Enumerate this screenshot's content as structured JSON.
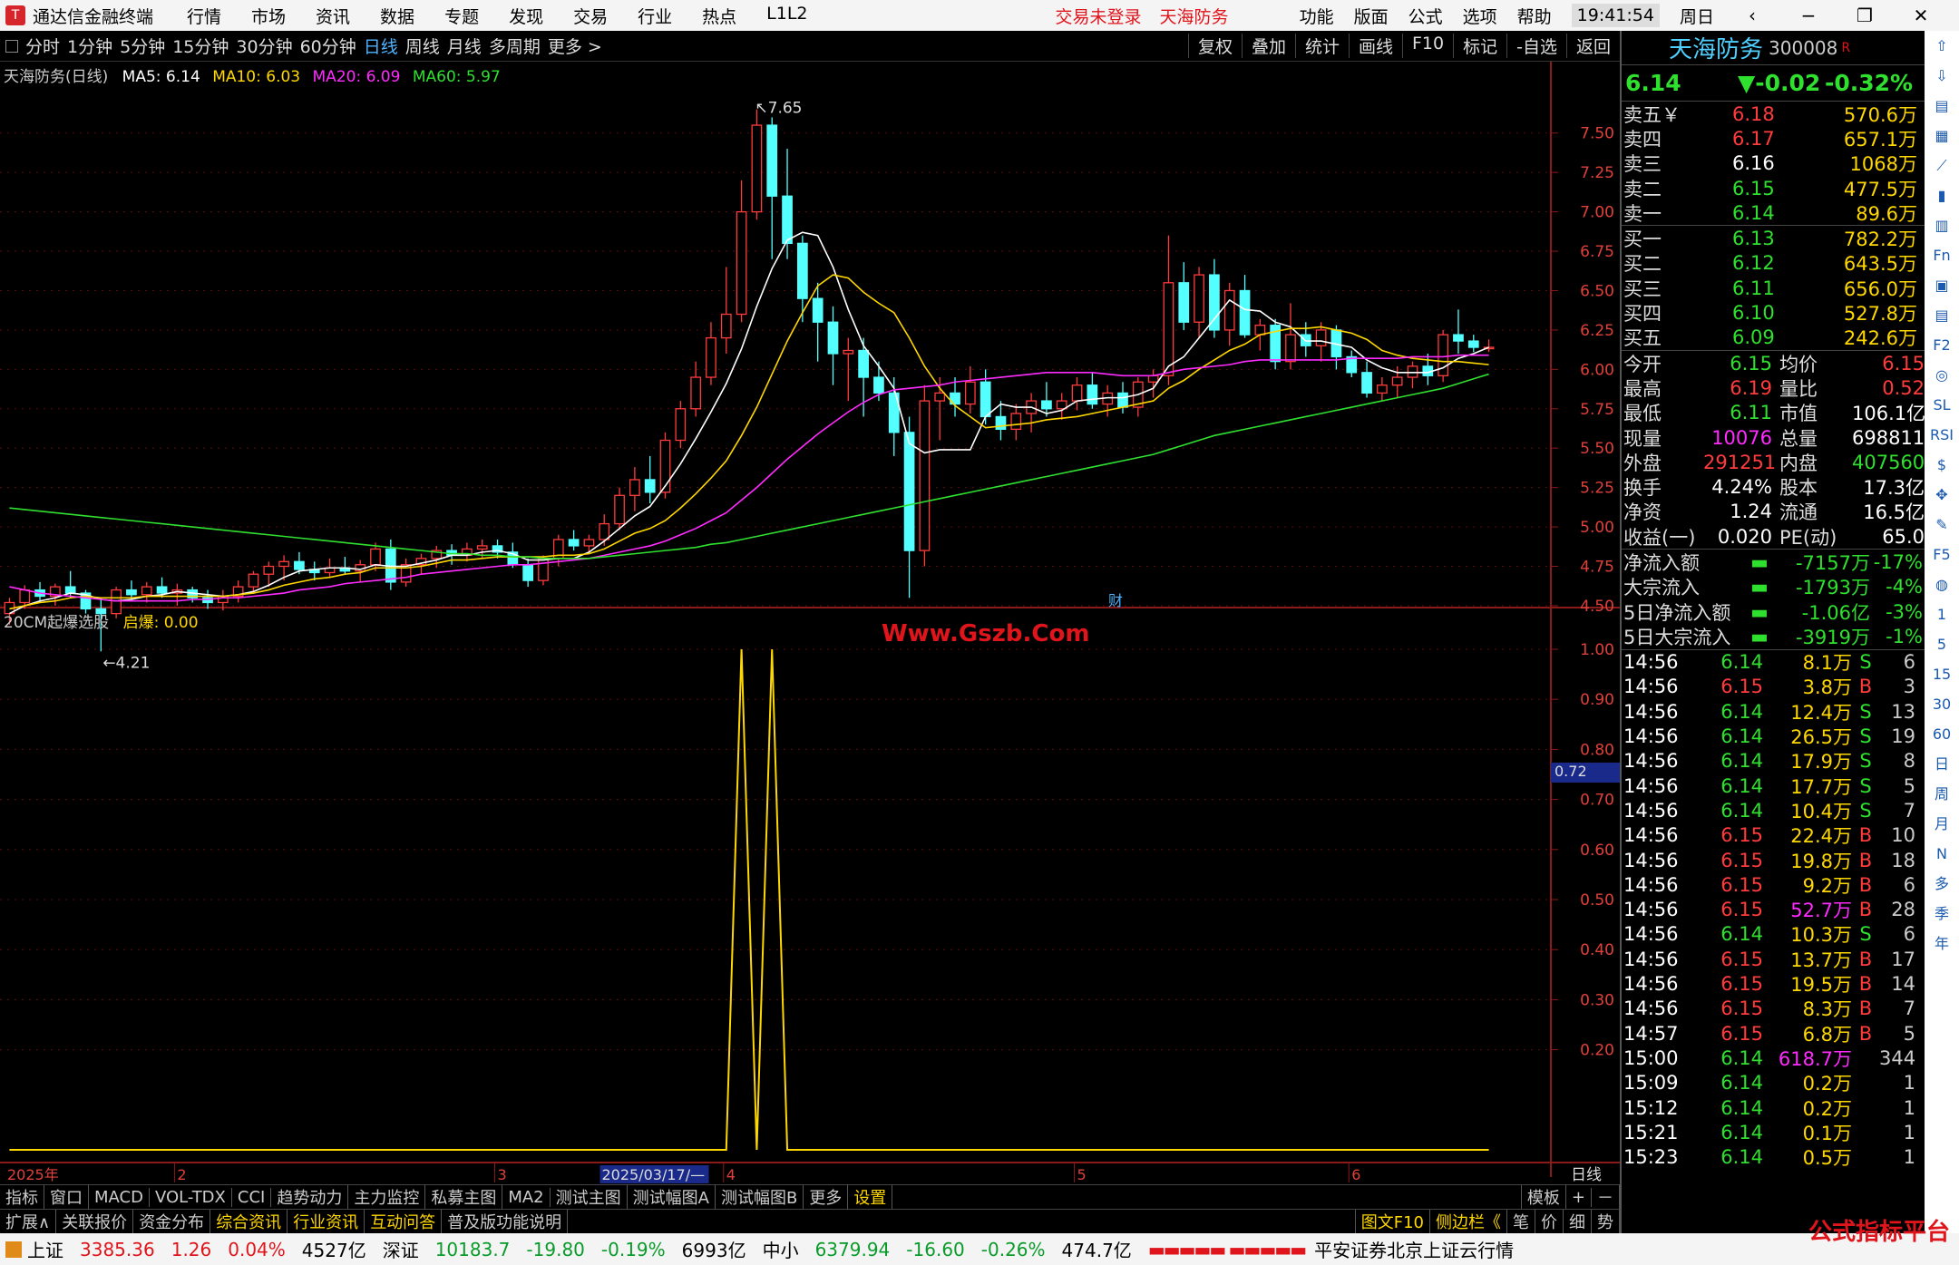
{
  "app": {
    "title": "通达信金融终端",
    "menu": [
      "行情",
      "市场",
      "资讯",
      "数据",
      "专题",
      "发现",
      "交易",
      "行业",
      "热点",
      "L1L2"
    ],
    "warning": "交易未登录",
    "stock_tag": "天海防务",
    "right_menu": [
      "功能",
      "版面",
      "公式",
      "选项",
      "帮助"
    ],
    "clock": "19:41:54",
    "weekday": "周日"
  },
  "toolbar": {
    "timeframes": [
      "分时",
      "1分钟",
      "5分钟",
      "15分钟",
      "30分钟",
      "60分钟",
      "日线",
      "周线",
      "月线",
      "多周期",
      "更多 >"
    ],
    "active": "日线",
    "tools": [
      "复权",
      "叠加",
      "统计",
      "画线",
      "F10",
      "标记",
      "-自选",
      "返回"
    ]
  },
  "chart_info": {
    "name": "天海防务(日线)",
    "ma5": "MA5: 6.14",
    "ma10": "MA10: 6.03",
    "ma20": "MA20: 6.09",
    "ma60": "MA60: 5.97",
    "high_label": "7.65",
    "low_label": "4.21",
    "cai": "财"
  },
  "indicator_info": {
    "name": "20CM起爆选股",
    "value_label": "启爆: 0.00",
    "watermark": "Www.Gszb.Com",
    "current_value": "0.72"
  },
  "axes": {
    "price_ticks": [
      "7.50",
      "7.25",
      "7.00",
      "6.75",
      "6.50",
      "6.25",
      "6.00",
      "5.75",
      "5.50",
      "5.25",
      "5.00",
      "4.75",
      "4.50"
    ],
    "ind_ticks": [
      "1.00",
      "0.90",
      "0.80",
      "0.70",
      "0.60",
      "0.50",
      "0.40",
      "0.30",
      "0.20"
    ],
    "date_labels": [
      "2025年",
      "2",
      "3",
      "2025/03/17/—",
      "4",
      "5",
      "6"
    ],
    "period": "日线"
  },
  "chart_data": {
    "type": "candlestick",
    "ohlc": [
      [
        4.45,
        4.55,
        4.38,
        4.52
      ],
      [
        4.52,
        4.63,
        4.48,
        4.6
      ],
      [
        4.6,
        4.65,
        4.52,
        4.56
      ],
      [
        4.56,
        4.64,
        4.5,
        4.62
      ],
      [
        4.62,
        4.72,
        4.55,
        4.58
      ],
      [
        4.58,
        4.6,
        4.45,
        4.48
      ],
      [
        4.48,
        4.55,
        4.21,
        4.45
      ],
      [
        4.45,
        4.62,
        4.42,
        4.6
      ],
      [
        4.6,
        4.66,
        4.54,
        4.57
      ],
      [
        4.57,
        4.65,
        4.52,
        4.62
      ],
      [
        4.62,
        4.68,
        4.55,
        4.58
      ],
      [
        4.58,
        4.64,
        4.5,
        4.6
      ],
      [
        4.6,
        4.62,
        4.52,
        4.55
      ],
      [
        4.55,
        4.6,
        4.48,
        4.52
      ],
      [
        4.52,
        4.6,
        4.47,
        4.56
      ],
      [
        4.56,
        4.66,
        4.52,
        4.62
      ],
      [
        4.62,
        4.72,
        4.58,
        4.7
      ],
      [
        4.7,
        4.78,
        4.62,
        4.75
      ],
      [
        4.75,
        4.82,
        4.66,
        4.78
      ],
      [
        4.78,
        4.84,
        4.7,
        4.73
      ],
      [
        4.73,
        4.78,
        4.66,
        4.71
      ],
      [
        4.71,
        4.8,
        4.68,
        4.74
      ],
      [
        4.74,
        4.81,
        4.7,
        4.72
      ],
      [
        4.72,
        4.79,
        4.65,
        4.76
      ],
      [
        4.76,
        4.9,
        4.72,
        4.86
      ],
      [
        4.86,
        4.92,
        4.6,
        4.65
      ],
      [
        4.65,
        4.8,
        4.62,
        4.76
      ],
      [
        4.76,
        4.83,
        4.7,
        4.8
      ],
      [
        4.8,
        4.88,
        4.74,
        4.85
      ],
      [
        4.85,
        4.89,
        4.76,
        4.82
      ],
      [
        4.82,
        4.9,
        4.78,
        4.86
      ],
      [
        4.86,
        4.92,
        4.8,
        4.88
      ],
      [
        4.88,
        4.92,
        4.8,
        4.84
      ],
      [
        4.84,
        4.9,
        4.74,
        4.76
      ],
      [
        4.76,
        4.8,
        4.62,
        4.66
      ],
      [
        4.66,
        4.82,
        4.63,
        4.8
      ],
      [
        4.8,
        4.95,
        4.75,
        4.92
      ],
      [
        4.92,
        4.98,
        4.85,
        4.88
      ],
      [
        4.88,
        4.95,
        4.84,
        4.92
      ],
      [
        4.92,
        5.08,
        4.88,
        5.02
      ],
      [
        5.02,
        5.25,
        4.98,
        5.2
      ],
      [
        5.2,
        5.38,
        5.1,
        5.3
      ],
      [
        5.3,
        5.45,
        5.15,
        5.22
      ],
      [
        5.22,
        5.6,
        5.18,
        5.55
      ],
      [
        5.55,
        5.8,
        5.5,
        5.75
      ],
      [
        5.75,
        6.05,
        5.7,
        5.95
      ],
      [
        5.95,
        6.3,
        5.9,
        6.2
      ],
      [
        6.2,
        6.65,
        6.1,
        6.35
      ],
      [
        6.35,
        7.2,
        6.3,
        7.0
      ],
      [
        7.0,
        7.65,
        6.95,
        7.55
      ],
      [
        7.55,
        7.6,
        6.7,
        7.1
      ],
      [
        7.1,
        7.4,
        6.7,
        6.8
      ],
      [
        6.8,
        6.85,
        6.3,
        6.45
      ],
      [
        6.45,
        6.55,
        6.05,
        6.3
      ],
      [
        6.3,
        6.4,
        5.9,
        6.1
      ],
      [
        6.1,
        6.2,
        5.8,
        6.12
      ],
      [
        6.12,
        6.2,
        5.7,
        5.95
      ],
      [
        5.95,
        6.05,
        5.8,
        5.85
      ],
      [
        5.85,
        5.95,
        5.45,
        5.6
      ],
      [
        5.6,
        5.7,
        4.55,
        4.85
      ],
      [
        4.85,
        5.9,
        4.75,
        5.8
      ],
      [
        5.8,
        5.95,
        5.55,
        5.85
      ],
      [
        5.85,
        5.95,
        5.7,
        5.78
      ],
      [
        5.78,
        6.02,
        5.72,
        5.92
      ],
      [
        5.92,
        6.0,
        5.65,
        5.7
      ],
      [
        5.7,
        5.8,
        5.55,
        5.62
      ],
      [
        5.62,
        5.78,
        5.55,
        5.72
      ],
      [
        5.72,
        5.85,
        5.6,
        5.8
      ],
      [
        5.8,
        5.92,
        5.7,
        5.75
      ],
      [
        5.75,
        5.85,
        5.68,
        5.8
      ],
      [
        5.8,
        5.95,
        5.74,
        5.9
      ],
      [
        5.9,
        5.98,
        5.75,
        5.78
      ],
      [
        5.78,
        5.9,
        5.7,
        5.85
      ],
      [
        5.85,
        5.92,
        5.72,
        5.76
      ],
      [
        5.76,
        5.95,
        5.7,
        5.92
      ],
      [
        5.92,
        6.0,
        5.82,
        5.96
      ],
      [
        5.96,
        6.85,
        5.9,
        6.55
      ],
      [
        6.55,
        6.68,
        6.25,
        6.3
      ],
      [
        6.3,
        6.65,
        6.2,
        6.6
      ],
      [
        6.6,
        6.7,
        6.2,
        6.25
      ],
      [
        6.25,
        6.55,
        6.15,
        6.5
      ],
      [
        6.5,
        6.6,
        6.2,
        6.22
      ],
      [
        6.22,
        6.32,
        6.12,
        6.28
      ],
      [
        6.28,
        6.32,
        6.0,
        6.05
      ],
      [
        6.05,
        6.42,
        6.0,
        6.22
      ],
      [
        6.22,
        6.3,
        6.08,
        6.15
      ],
      [
        6.15,
        6.3,
        6.05,
        6.25
      ],
      [
        6.25,
        6.28,
        6.0,
        6.08
      ],
      [
        6.08,
        6.12,
        5.95,
        5.98
      ],
      [
        5.98,
        6.05,
        5.82,
        5.85
      ],
      [
        5.85,
        5.95,
        5.8,
        5.9
      ],
      [
        5.9,
        6.02,
        5.82,
        5.95
      ],
      [
        5.95,
        6.05,
        5.88,
        6.02
      ],
      [
        6.02,
        6.1,
        5.9,
        5.96
      ],
      [
        5.96,
        6.25,
        5.92,
        6.22
      ],
      [
        6.22,
        6.38,
        6.1,
        6.18
      ],
      [
        6.18,
        6.22,
        6.11,
        6.14
      ],
      [
        6.14,
        6.19,
        6.11,
        6.14
      ]
    ],
    "ma5": [
      4.45,
      4.5,
      4.53,
      4.55,
      4.58,
      4.57,
      4.54,
      4.53,
      4.54,
      4.56,
      4.57,
      4.59,
      4.58,
      4.57,
      4.56,
      4.57,
      4.59,
      4.63,
      4.68,
      4.72,
      4.73,
      4.74,
      4.74,
      4.73,
      4.76,
      4.75,
      4.75,
      4.77,
      4.79,
      4.82,
      4.82,
      4.84,
      4.85,
      4.83,
      4.79,
      4.79,
      4.8,
      4.8,
      4.84,
      4.91,
      4.99,
      5.07,
      5.13,
      5.26,
      5.4,
      5.56,
      5.73,
      5.91,
      6.13,
      6.4,
      6.64,
      6.82,
      6.87,
      6.85,
      6.65,
      6.38,
      6.15,
      6.02,
      5.88,
      5.53,
      5.47,
      5.49,
      5.49,
      5.49,
      5.7,
      5.78,
      5.76,
      5.76,
      5.72,
      5.74,
      5.8,
      5.81,
      5.82,
      5.82,
      5.84,
      5.88,
      6.02,
      6.08,
      6.2,
      6.32,
      6.44,
      6.38,
      6.37,
      6.3,
      6.27,
      6.18,
      6.18,
      6.16,
      6.14,
      6.06,
      6.01,
      5.98,
      5.98,
      5.98,
      6.01,
      6.07,
      6.1,
      6.14
    ],
    "ma10": [
      4.48,
      4.5,
      4.52,
      4.53,
      4.55,
      4.56,
      4.55,
      4.55,
      4.55,
      4.56,
      4.56,
      4.56,
      4.56,
      4.56,
      4.56,
      4.57,
      4.58,
      4.6,
      4.63,
      4.65,
      4.67,
      4.68,
      4.7,
      4.71,
      4.74,
      4.74,
      4.74,
      4.75,
      4.77,
      4.79,
      4.79,
      4.8,
      4.81,
      4.81,
      4.81,
      4.81,
      4.82,
      4.82,
      4.83,
      4.86,
      4.91,
      4.96,
      4.99,
      5.04,
      5.12,
      5.21,
      5.31,
      5.42,
      5.58,
      5.76,
      5.97,
      6.18,
      6.36,
      6.53,
      6.6,
      6.58,
      6.49,
      6.42,
      6.36,
      6.2,
      6.02,
      5.88,
      5.77,
      5.7,
      5.63,
      5.64,
      5.65,
      5.66,
      5.68,
      5.69,
      5.7,
      5.72,
      5.74,
      5.76,
      5.78,
      5.8,
      5.88,
      5.93,
      6.0,
      6.06,
      6.12,
      6.16,
      6.22,
      6.24,
      6.26,
      6.26,
      6.27,
      6.25,
      6.23,
      6.19,
      6.12,
      6.09,
      6.07,
      6.06,
      6.05,
      6.05,
      6.04,
      6.03
    ],
    "ma20": [
      4.62,
      4.6,
      4.58,
      4.57,
      4.56,
      4.55,
      4.54,
      4.53,
      4.53,
      4.53,
      4.53,
      4.53,
      4.54,
      4.54,
      4.55,
      4.55,
      4.56,
      4.57,
      4.58,
      4.6,
      4.61,
      4.62,
      4.64,
      4.65,
      4.66,
      4.67,
      4.68,
      4.7,
      4.71,
      4.72,
      4.73,
      4.74,
      4.75,
      4.76,
      4.76,
      4.77,
      4.78,
      4.79,
      4.8,
      4.82,
      4.84,
      4.86,
      4.88,
      4.91,
      4.95,
      4.99,
      5.04,
      5.09,
      5.17,
      5.25,
      5.34,
      5.43,
      5.51,
      5.59,
      5.66,
      5.73,
      5.79,
      5.84,
      5.87,
      5.88,
      5.89,
      5.9,
      5.92,
      5.93,
      5.94,
      5.95,
      5.96,
      5.97,
      5.98,
      5.98,
      5.98,
      5.98,
      5.97,
      5.96,
      5.96,
      5.96,
      5.98,
      6.0,
      6.01,
      6.02,
      6.03,
      6.05,
      6.06,
      6.06,
      6.06,
      6.06,
      6.06,
      6.06,
      6.07,
      6.07,
      6.07,
      6.07,
      6.08,
      6.08,
      6.08,
      6.09,
      6.09,
      6.09
    ],
    "ma60": [
      5.12,
      5.11,
      5.1,
      5.09,
      5.08,
      5.07,
      5.06,
      5.05,
      5.04,
      5.03,
      5.02,
      5.01,
      5.0,
      4.99,
      4.98,
      4.97,
      4.96,
      4.95,
      4.94,
      4.93,
      4.92,
      4.91,
      4.9,
      4.89,
      4.88,
      4.87,
      4.86,
      4.85,
      4.84,
      4.83,
      4.83,
      4.82,
      4.82,
      4.81,
      4.81,
      4.8,
      4.8,
      4.8,
      4.8,
      4.81,
      4.82,
      4.83,
      4.84,
      4.85,
      4.86,
      4.87,
      4.89,
      4.9,
      4.92,
      4.94,
      4.96,
      4.98,
      5.0,
      5.02,
      5.04,
      5.06,
      5.08,
      5.1,
      5.12,
      5.14,
      5.16,
      5.18,
      5.2,
      5.22,
      5.24,
      5.26,
      5.28,
      5.3,
      5.32,
      5.34,
      5.36,
      5.38,
      5.4,
      5.42,
      5.44,
      5.46,
      5.49,
      5.52,
      5.55,
      5.58,
      5.6,
      5.62,
      5.64,
      5.66,
      5.68,
      5.7,
      5.72,
      5.74,
      5.76,
      5.78,
      5.8,
      5.82,
      5.84,
      5.86,
      5.88,
      5.91,
      5.94,
      5.97
    ],
    "indicator": [
      0,
      0,
      0,
      0,
      0,
      0,
      0,
      0,
      0,
      0,
      0,
      0,
      0,
      0,
      0,
      0,
      0,
      0,
      0,
      0,
      0,
      0,
      0,
      0,
      0,
      0,
      0,
      0,
      0,
      0,
      0,
      0,
      0,
      0,
      0,
      0,
      0,
      0,
      0,
      0,
      0,
      0,
      0,
      0,
      0,
      0,
      0,
      0,
      1,
      0,
      1,
      0,
      0,
      0,
      0,
      0,
      0,
      0,
      0,
      0,
      0,
      0,
      0,
      0,
      0,
      0,
      0,
      0,
      0,
      0,
      0,
      0,
      0,
      0,
      0,
      0,
      0,
      0,
      0,
      0,
      0,
      0,
      0,
      0,
      0,
      0,
      0,
      0,
      0,
      0,
      0,
      0,
      0,
      0,
      0,
      0,
      0,
      0
    ],
    "price_range": [
      4.21,
      7.65
    ],
    "ind_range": [
      0,
      1
    ]
  },
  "quote": {
    "name": "天海防务",
    "code": "300008",
    "tag": "R",
    "price": "6.14",
    "change": "▼-0.02",
    "pct": "-0.32%",
    "asks": [
      [
        "卖五￥",
        "6.18",
        "570.6万"
      ],
      [
        "卖四",
        "6.17",
        "657.1万"
      ],
      [
        "卖三",
        "6.16",
        "1068万"
      ],
      [
        "卖二",
        "6.15",
        "477.5万"
      ],
      [
        "卖一",
        "6.14",
        "89.6万"
      ]
    ],
    "bids": [
      [
        "买一",
        "6.13",
        "782.2万"
      ],
      [
        "买二",
        "6.12",
        "643.5万"
      ],
      [
        "买三",
        "6.11",
        "656.0万"
      ],
      [
        "买四",
        "6.10",
        "527.8万"
      ],
      [
        "买五",
        "6.09",
        "242.6万"
      ]
    ],
    "stats": [
      [
        "今开",
        "6.15",
        "均价",
        "6.15"
      ],
      [
        "最高",
        "6.19",
        "量比",
        "0.52"
      ],
      [
        "最低",
        "6.11",
        "市值",
        "106.1亿"
      ],
      [
        "现量",
        "10076",
        "总量",
        "698811"
      ],
      [
        "外盘",
        "291251",
        "内盘",
        "407560"
      ],
      [
        "换手",
        "4.24%",
        "股本",
        "17.3亿"
      ],
      [
        "净资",
        "1.24",
        "流通",
        "16.5亿"
      ],
      [
        "收益(一)",
        "0.020",
        "PE(动)",
        "65.0"
      ]
    ],
    "flows": [
      [
        "净流入额",
        "-7157万",
        "-17%"
      ],
      [
        "大宗流入",
        "-1793万",
        "-4%"
      ],
      [
        "5日净流入额",
        "-1.06亿",
        "-3%"
      ],
      [
        "5日大宗流入",
        "-3919万",
        "-1%"
      ]
    ],
    "ticks": [
      [
        "14:56",
        "6.14",
        "8.1万",
        "S",
        "6"
      ],
      [
        "14:56",
        "6.15",
        "3.8万",
        "B",
        "3"
      ],
      [
        "14:56",
        "6.14",
        "12.4万",
        "S",
        "13"
      ],
      [
        "14:56",
        "6.14",
        "26.5万",
        "S",
        "19"
      ],
      [
        "14:56",
        "6.14",
        "17.9万",
        "S",
        "8"
      ],
      [
        "14:56",
        "6.14",
        "17.7万",
        "S",
        "5"
      ],
      [
        "14:56",
        "6.14",
        "10.4万",
        "S",
        "7"
      ],
      [
        "14:56",
        "6.15",
        "22.4万",
        "B",
        "10"
      ],
      [
        "14:56",
        "6.15",
        "19.8万",
        "B",
        "18"
      ],
      [
        "14:56",
        "6.15",
        "9.2万",
        "B",
        "6"
      ],
      [
        "14:56",
        "6.15",
        "52.7万",
        "B",
        "28"
      ],
      [
        "14:56",
        "6.14",
        "10.3万",
        "S",
        "6"
      ],
      [
        "14:56",
        "6.15",
        "13.7万",
        "B",
        "17"
      ],
      [
        "14:56",
        "6.15",
        "19.5万",
        "B",
        "14"
      ],
      [
        "14:56",
        "6.15",
        "8.3万",
        "B",
        "7"
      ],
      [
        "14:57",
        "6.15",
        "6.8万",
        "B",
        "5"
      ],
      [
        "15:00",
        "6.14",
        "618.7万",
        "",
        "344"
      ],
      [
        "15:09",
        "6.14",
        "0.2万",
        "",
        "1"
      ],
      [
        "15:12",
        "6.14",
        "0.2万",
        "",
        "1"
      ],
      [
        "15:21",
        "6.14",
        "0.1万",
        "",
        "1"
      ],
      [
        "15:23",
        "6.14",
        "0.5万",
        "",
        "1"
      ]
    ]
  },
  "bottom_tabs1": [
    "指标",
    "窗口",
    "MACD",
    "VOL-TDX",
    "CCI",
    "趋势动力",
    "主力监控",
    "私募主图",
    "MA2",
    "测试主图",
    "测试幅图A",
    "测试幅图B",
    "更多",
    "设置"
  ],
  "bottom_tabs1_right": [
    "模板",
    "+",
    "－"
  ],
  "bottom_tabs2": [
    "扩展∧",
    "关联报价",
    "资金分布",
    "综合资讯",
    "行业资讯",
    "互动问答",
    "普及版功能说明"
  ],
  "bottom_tabs2_right": [
    "图文F10",
    "侧边栏《",
    "笔",
    "价",
    "细",
    "势"
  ],
  "status": {
    "sh_label": "上证",
    "sh": "3385.36",
    "sh_chg": "1.26",
    "sh_pct": "0.04%",
    "sh_amt": "4527亿",
    "sz_label": "深证",
    "sz": "10183.7",
    "sz_chg": "-19.80",
    "sz_pct": "-0.19%",
    "sz_amt": "6993亿",
    "zx_label": "中小",
    "zx": "6379.94",
    "zx_chg": "-16.60",
    "zx_pct": "-0.26%",
    "zx_amt": "474.7亿",
    "server": "平安证券北京上证云行情",
    "brand": "公式指标平台"
  },
  "sidebar": [
    "⇧",
    "⇩",
    "▤",
    "▦",
    "⟋",
    "▮",
    "▥",
    "Fn",
    "▣",
    "▤",
    "F2",
    "◎",
    "SL",
    "RSI",
    "$",
    "✥",
    "✎",
    "F5",
    "◍",
    "1",
    "5",
    "15",
    "30",
    "60",
    "日",
    "周",
    "月",
    "N",
    "多",
    "季",
    "年"
  ]
}
